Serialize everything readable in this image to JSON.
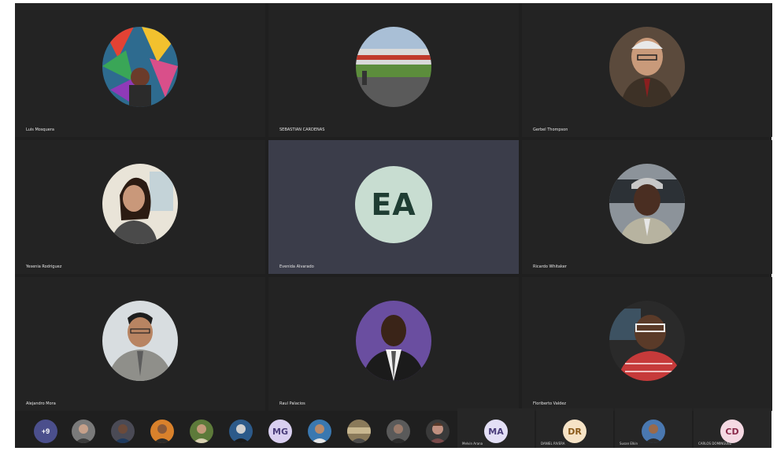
{
  "meeting": {
    "tiles": [
      {
        "name": "Luis Mosquera",
        "avatar": "colorful-painting-photo"
      },
      {
        "name": "SEBASTIAN CARDENAS",
        "avatar": "racetrack-photo"
      },
      {
        "name": "Gerbel Thompson",
        "avatar": "elderly-man-glasses-photo"
      },
      {
        "name": "Yesenia Rodriguez",
        "avatar": "woman-smiling-photo"
      },
      {
        "name": "Evenida Alvarado",
        "initials": "EA",
        "active": true
      },
      {
        "name": "Ricardo Whitaker",
        "avatar": "man-cap-photo"
      },
      {
        "name": "Alejandro Mora",
        "avatar": "man-suit-photo"
      },
      {
        "name": "Raul Palacios",
        "avatar": "man-purple-background-photo"
      },
      {
        "name": "Floriberto Valdez",
        "avatar": "man-glasses-photo"
      }
    ],
    "strip": {
      "more_count": "+9",
      "initials_avatar": "MG",
      "participants": [
        {
          "initials": "MA",
          "name": "Melvin Arana"
        },
        {
          "initials": "DR",
          "name": "DANIEL RIVERA"
        },
        {
          "initials": "",
          "name": "Susan Elkin"
        },
        {
          "initials": "CD",
          "name": "CARLOS DOMINGUEZ"
        }
      ]
    }
  },
  "colors": {
    "background": "#1f1f1f",
    "tile": "#232323",
    "active_tile": "#3b3d4a",
    "accent": "#4b4f8c"
  }
}
